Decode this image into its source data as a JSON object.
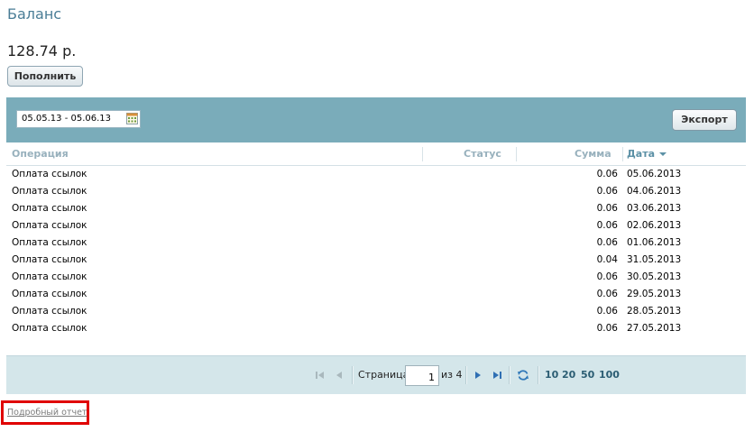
{
  "page": {
    "title": "Баланс"
  },
  "balance": {
    "amount": "128.74 р.",
    "topup_label": "Пополнить"
  },
  "filters": {
    "date_range": "05.05.13 - 05.06.13",
    "export_label": "Экспорт"
  },
  "table": {
    "columns": {
      "operation": "Операция",
      "status": "Статус",
      "amount": "Сумма",
      "date": "Дата"
    },
    "sort": {
      "column": "date",
      "direction": "desc"
    },
    "rows": [
      {
        "operation": "Оплата ссылок",
        "status": "",
        "amount": "0.06",
        "date": "05.06.2013"
      },
      {
        "operation": "Оплата ссылок",
        "status": "",
        "amount": "0.06",
        "date": "04.06.2013"
      },
      {
        "operation": "Оплата ссылок",
        "status": "",
        "amount": "0.06",
        "date": "03.06.2013"
      },
      {
        "operation": "Оплата ссылок",
        "status": "",
        "amount": "0.06",
        "date": "02.06.2013"
      },
      {
        "operation": "Оплата ссылок",
        "status": "",
        "amount": "0.06",
        "date": "01.06.2013"
      },
      {
        "operation": "Оплата ссылок",
        "status": "",
        "amount": "0.04",
        "date": "31.05.2013"
      },
      {
        "operation": "Оплата ссылок",
        "status": "",
        "amount": "0.06",
        "date": "30.05.2013"
      },
      {
        "operation": "Оплата ссылок",
        "status": "",
        "amount": "0.06",
        "date": "29.05.2013"
      },
      {
        "operation": "Оплата ссылок",
        "status": "",
        "amount": "0.06",
        "date": "28.05.2013"
      },
      {
        "operation": "Оплата ссылок",
        "status": "",
        "amount": "0.06",
        "date": "27.05.2013"
      }
    ]
  },
  "pager": {
    "page_label": "Страница",
    "current_page": "1",
    "of_label": "из 4",
    "page_sizes": [
      "10",
      "20",
      "50",
      "100"
    ]
  },
  "footer": {
    "report_link": "Подробный отчет"
  },
  "colors": {
    "title": "#4a7d96",
    "toolbar": "#7aacba",
    "pager_bg": "#d4e6ea",
    "highlight_border": "#e00000"
  }
}
